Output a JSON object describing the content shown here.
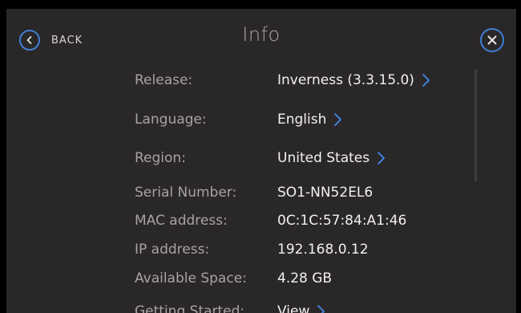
{
  "header": {
    "back_label": "BACK",
    "title": "Info",
    "accent_color": "#3f7fd8"
  },
  "rows": [
    {
      "label": "Release:",
      "value": "Inverness (3.3.15.0)",
      "has_chevron": true
    },
    {
      "label": "Language:",
      "value": "English",
      "has_chevron": true
    },
    {
      "label": "Region:",
      "value": "United States",
      "has_chevron": true
    },
    {
      "label": "Serial Number:",
      "value": "SO1-NN52EL6",
      "has_chevron": false
    },
    {
      "label": "MAC address:",
      "value": "0C:1C:57:84:A1:46",
      "has_chevron": false
    },
    {
      "label": "IP address:",
      "value": "192.168.0.12",
      "has_chevron": false
    },
    {
      "label": "Available Space:",
      "value": "4.28 GB",
      "has_chevron": false
    },
    {
      "label": "Getting Started:",
      "value": "View",
      "has_chevron": true
    }
  ],
  "icons": {
    "back": "chevron-left-circle-icon",
    "close": "close-circle-icon",
    "row_chevron": "chevron-right-icon"
  }
}
